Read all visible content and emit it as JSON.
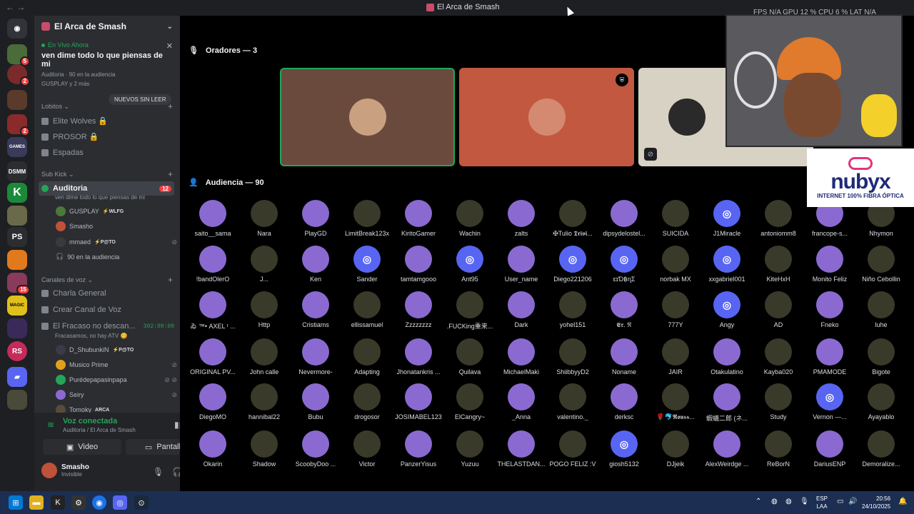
{
  "titlebar": {
    "title": "El Arca de Smash",
    "stats": "FPS N/A   GPU 12 %   CPU 6 %   LAT N/A"
  },
  "server": {
    "name": "El Arca de Smash"
  },
  "live": {
    "label": "En Vivo Ahora",
    "topic": "ven dime todo lo que piensas de mi",
    "audience": "Auditoria  ·  90 en la audiencia",
    "users": "GUSPLAY y 2 más"
  },
  "unread_pill": "NUEVOS SIN LEER",
  "categories": {
    "lobitos": "Lobitos",
    "subkick": "Sub Kick",
    "voice": "Canales de voz"
  },
  "lobitos_channels": [
    "Elite Wolves 🔒",
    "PROSOR 🔒",
    "Espadas"
  ],
  "auditoria": {
    "name": "Auditoria",
    "sub": "ven dime todo lo que piensas de mi",
    "count": "12"
  },
  "auditoria_members": [
    {
      "name": "GUSPLAY",
      "tag": "⚡WLFG"
    },
    {
      "name": "Smasho",
      "tag": ""
    },
    {
      "name": "mmaed",
      "tag": "⚡P@TO"
    }
  ],
  "auditoria_audience": "90 en la audiencia",
  "voice_channels": {
    "general": "Charla General",
    "create": "Crear Canal de Voz",
    "fracaso": "El Fracaso no descan...",
    "fracaso_time": "302:09:00",
    "fracaso_sub": "Fracasamos, no hay ATV 😋"
  },
  "fracaso_members": [
    {
      "name": "D_ShubunkiN",
      "tag": "⚡P@TO"
    },
    {
      "name": "Musico Prime",
      "tag": ""
    },
    {
      "name": "Purédepapasinpapa",
      "tag": ""
    },
    {
      "name": "Seiry",
      "tag": ""
    },
    {
      "name": "Tomoky",
      "tag": "ARCA"
    }
  ],
  "voice_panel": {
    "status": "Voz conectada",
    "location": "Auditoria / El Arca de Smash",
    "video": "Video",
    "screen": "Pantalla"
  },
  "user": {
    "name": "Smasho",
    "status": "Invisible"
  },
  "speakers_title": "Oradores — 3",
  "audience_title": "Audiencia — 90",
  "speaker_colors": [
    "#6b4a3e",
    "#c2583f",
    "#d8d2c4"
  ],
  "audience": [
    "saito__sama",
    "Nara",
    "PlayGD",
    "LimitBreak123x",
    "KiritoGamer",
    "Wachin",
    "zalts",
    "✠Tulio 𝕿𝖗𝖎𝖛𝖎...",
    "dipsydelostel...",
    "SUICIDA",
    "J1Miracle",
    "antoniomm8",
    "francope-s...",
    "Nhymon",
    "!bandOlerO",
    "J...",
    "Ken",
    "Sander",
    "tamtamgooo",
    "Ant95",
    "User_name",
    "Diego221206",
    "ɛɪƊ฿ɳƩ",
    "norbak MX",
    "xxgabriel001",
    "KiteHxH",
    "Monito Feliz",
    "Niño Cebollin",
    "ゐ ™• AXEL ᵗ ...",
    "Http",
    "Cristiams",
    "ellissamuel",
    "Zzzzzzzz",
    ".FUCKing重来...",
    "Dark",
    "yohel151",
    "𝕰𝖗. ℜ",
    "777Y",
    "Angy",
    "AD",
    "Fneko",
    "luhe",
    "ORIGINAL PV...",
    "John calle",
    "Nevermore-",
    "Adapting",
    "Jhonatankris ...",
    "Quilava",
    "MichaelMaki",
    "ShiibbyyD2",
    "Noname",
    "JAIR",
    "Otakulatino",
    "Kayba020",
    "PMAMODE",
    "Bigote",
    "DiegoMO",
    "hannibal22",
    "Bubu",
    "drogosor",
    "JOSIMABEL123",
    "ElCangry~",
    "_Anna",
    "valentino._",
    "derksc",
    "🌹🐬𝕽𝖔𝖚𝖘𝖘...",
    "蝦蟻二郎 (ネ...",
    "Study",
    "Vernon —...",
    "Ayayablo",
    "Okarin",
    "Shadow",
    "ScoobyDoo ...",
    "Victor",
    "PanzerYisus",
    "Yuzuu",
    "THELASTDAN...",
    "POGO FELIZ :V",
    "giosh5132",
    "DJjeik",
    "AlexWeirdge ...",
    "ReBorN",
    "DariusENP",
    "Demoralize..."
  ],
  "brand": {
    "name": "nubyx",
    "tagline": "INTERNET 100% FIBRA ÓPTICA"
  },
  "taskbar": {
    "lang": "ESP",
    "lang2": "LAA",
    "time": "20:56",
    "date": "24/10/2025"
  }
}
